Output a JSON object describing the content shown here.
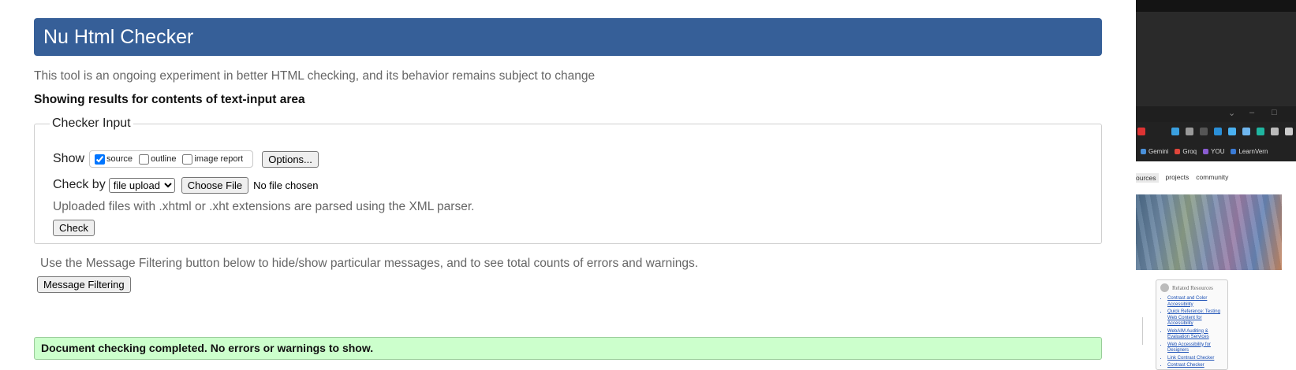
{
  "header": {
    "title": "Nu Html Checker"
  },
  "intro": {
    "tagline": "This tool is an ongoing experiment in better HTML checking, and its behavior remains subject to change",
    "results_heading": "Showing results for contents of text-input area"
  },
  "checker_input": {
    "legend": "Checker Input",
    "show_label": "Show",
    "show_options": [
      {
        "label": "source",
        "checked": true
      },
      {
        "label": "outline",
        "checked": false
      },
      {
        "label": "image report",
        "checked": false
      }
    ],
    "options_button": "Options...",
    "check_by_label": "Check by",
    "check_by_selected": "file upload",
    "choose_file_button": "Choose File",
    "file_status": "No file chosen",
    "upload_note": "Uploaded files with .xhtml or .xht extensions are parsed using the XML parser.",
    "check_button": "Check"
  },
  "filtering": {
    "note": "Use the Message Filtering button below to hide/show particular messages, and to see total counts of errors and warnings.",
    "button": "Message Filtering"
  },
  "result": {
    "message": "Document checking completed. No errors or warnings to show."
  },
  "side_window": {
    "bookmarks": [
      {
        "label": "Gemini",
        "color": "#4a90d9"
      },
      {
        "label": "Groq",
        "color": "#e0453a"
      },
      {
        "label": "YOU",
        "color": "#8a5cd1"
      },
      {
        "label": "LearnVern",
        "color": "#3a7bd5"
      }
    ],
    "nav": [
      "ources",
      "projects",
      "community"
    ],
    "related_title": "Related Resources",
    "related_links": [
      "Contrast and Color Accessibility",
      "Quick Reference: Testing Web Content for Accessibility",
      "WebAIM Auditing & Evaluation Services",
      "Web Accessibility for Designers",
      "Link Contrast Checker",
      "Contrast Checker"
    ]
  },
  "colors": {
    "header_bg": "#365f98",
    "success_bg": "#ccffcc"
  }
}
